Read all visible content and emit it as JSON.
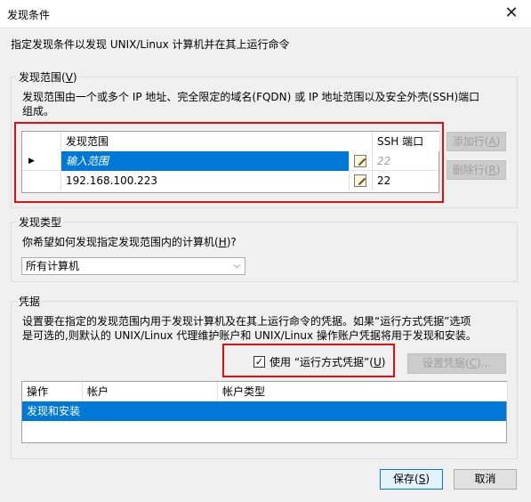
{
  "window": {
    "title": "发现条件",
    "close_glyph": "✕"
  },
  "intro": "指定发现条件以发现 UNIX/Linux 计算机并在其上运行命令",
  "range": {
    "group_title": "发现范围(",
    "group_key": "V",
    "desc_line1": "发现范围由一个或多个 IP 地址、完全限定的域名(FQDN) 或 IP 地址范围以及安全外壳(SSH)端口",
    "desc_line2": "组成。",
    "columns": [
      "发现范围",
      "SSH 端口"
    ],
    "rows": [
      {
        "marker": "▶",
        "range": "输入范围",
        "port": "22",
        "selected": true
      },
      {
        "marker": "",
        "range": "192.168.100.223",
        "port": "22",
        "selected": false
      }
    ],
    "add_button": "添加行(",
    "add_key": "A",
    "remove_button": "删除行(",
    "remove_key": "R"
  },
  "type": {
    "group_title": "发现类型",
    "question": "你希望如何发现指定发现范围内的计算机(",
    "question_key": "H",
    "question_tail": ")?",
    "select_value": "所有计算机",
    "arrow": "⌵"
  },
  "creds": {
    "group_title": "凭据",
    "desc_line1": "设置要在指定的发现范围内用于发现计算机及在其上运行命令的凭据。如果“运行方式凭据”选项",
    "desc_line2": "是可选的,则默认的 UNIX/Linux 代理维护账户和 UNIX/Linux 操作账户凭据将用于发现和安装。",
    "checkbox_label": "使用 “运行方式凭据”(",
    "checkbox_key": "U",
    "checkbox_checked": true,
    "set_button": "设置凭据(",
    "set_key": "C",
    "set_tail": ")...",
    "columns": [
      "操作",
      "帐户",
      "帐户类型"
    ],
    "rows": [
      {
        "action": "发现和安装",
        "account": "",
        "type": ""
      }
    ]
  },
  "footer": {
    "save": "保存(",
    "save_key": "S",
    "cancel": "取消"
  },
  "colors": {
    "selection": "#0078d7",
    "highlight_frame": "#e01010"
  }
}
